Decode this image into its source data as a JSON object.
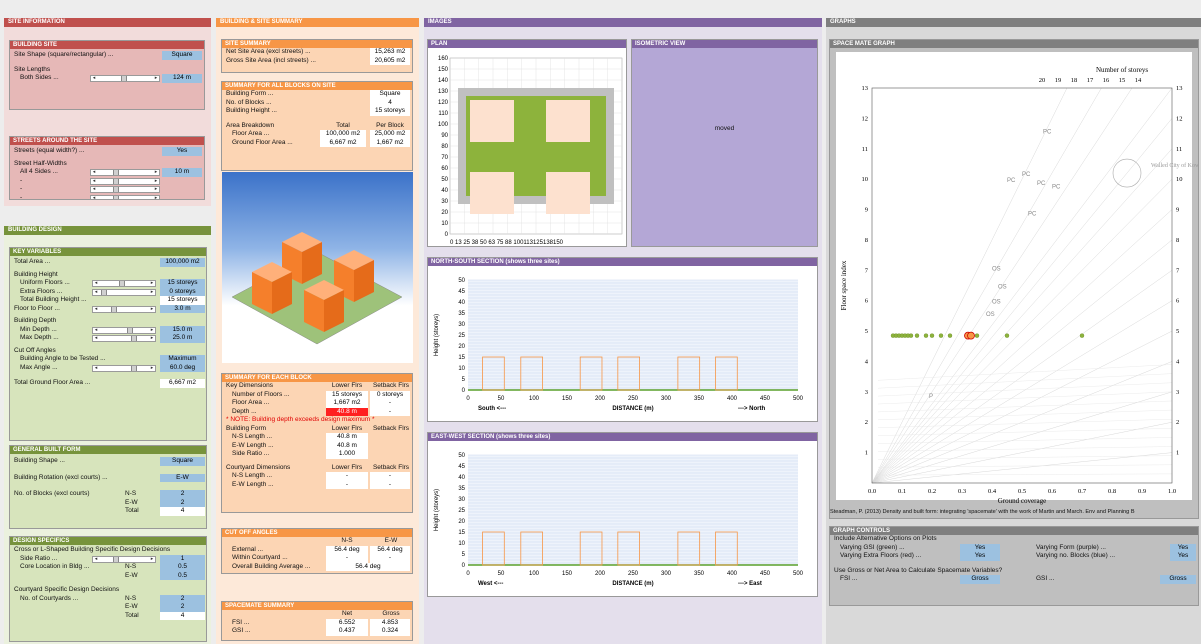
{
  "colors": {
    "site_red": "#c0504d",
    "site_bg": "#e6b8b7",
    "orange": "#f79646",
    "orange_bg": "#fcd5b4",
    "green": "#77933c",
    "green_bg": "#d7e4bc",
    "purple": "#8064a2",
    "purple_bg": "#ccc0da",
    "grey": "#7f7f7f",
    "blue_val": "#9cc1e0"
  },
  "site_info": {
    "title": "SITE INFORMATION",
    "building_site": {
      "title": "BUILDING SITE",
      "shape_label": "Site Shape (square/rectangular) ...",
      "shape_value": "Square",
      "lengths_label": "Site Lengths",
      "both_label": "Both Sides ...",
      "both_value": "124 m"
    },
    "streets": {
      "title": "STREETS AROUND THE SITE",
      "equal_label": "Streets (equal width?) ...",
      "equal_value": "Yes",
      "half_label": "Street Half-Widths",
      "all4_label": "All 4 Sides ...",
      "all4_value": "10 m",
      "dash": "-"
    }
  },
  "building_design": {
    "title": "BUILDING DESIGN",
    "key": {
      "title": "KEY VARIABLES",
      "total_area_label": "Total Area ...",
      "total_area_value": "100,000 m2",
      "height_label": "Building Height",
      "uniform_label": "Uniform Floors ...",
      "uniform_value": "15 storeys",
      "extra_label": "Extra Floors ...",
      "extra_value": "0 storeys",
      "total_height_label": "Total Building Height ...",
      "total_height_value": "15 storeys",
      "f2f_label": "Floor to Floor ...",
      "f2f_value": "3.0 m",
      "depth_label": "Building Depth",
      "min_depth_label": "Min Depth ...",
      "min_depth_value": "15.0 m",
      "max_depth_label": "Max Depth ...",
      "max_depth_value": "25.0 m",
      "cutoff_label": "Cut Off Angles",
      "tested_label": "Building Angle to be Tested ...",
      "tested_value": "Maximum",
      "max_angle_label": "Max Angle ...",
      "max_angle_value": "60.0 deg",
      "tgfa_label": "Total Ground Floor Area ...",
      "tgfa_value": "6,667 m2"
    },
    "general": {
      "title": "GENERAL BUILT FORM",
      "shape_label": "Building Shape ...",
      "shape_value": "Square",
      "rotation_label": "Building Rotation (excl courts) ...",
      "rotation_value": "E-W",
      "blocks_label": "No. of Blocks (excl courts)",
      "ns": "N-S",
      "ew": "E-W",
      "total": "Total",
      "ns_value": "2",
      "ew_value": "2",
      "total_value": "4"
    },
    "specifics": {
      "title": "DESIGN SPECIFICS",
      "cross_label": "Cross or L-Shaped Building Specific Design Decisions",
      "side_label": "Side Ratio ...",
      "side_value": "1",
      "core_label": "Core Location in Bldg ...",
      "ns": "N-S",
      "ew": "E-W",
      "core_ns": "0.5",
      "core_ew": "0.5",
      "court_label": "Courtyard Specific Design Decisions",
      "courts_label": "No. of Courtyards ...",
      "total": "Total",
      "c_ns": "2",
      "c_ew": "2",
      "c_total": "4"
    }
  },
  "summary": {
    "title": "BUILDING & SITE SUMMARY",
    "site": {
      "title": "SITE SUMMARY",
      "net_label": "Net Site Area (excl streets) ...",
      "net_value": "15,263 m2",
      "gross_label": "Gross Site Area (incl streets) ...",
      "gross_value": "20,605 m2"
    },
    "all_blocks": {
      "title": "SUMMARY FOR ALL BLOCKS ON SITE",
      "form_label": "Building Form ...",
      "form_value": "Square",
      "blocks_label": "No. of Blocks ...",
      "blocks_value": "4",
      "height_label": "Building Height ...",
      "height_value": "15 storeys",
      "breakdown_label": "Area Breakdown",
      "total_hdr": "Total",
      "per_hdr": "Per Block",
      "floor_label": "Floor Area ...",
      "floor_total": "100,000 m2",
      "floor_per": "25,000 m2",
      "gfa_label": "Ground Floor Area ...",
      "gfa_total": "6,667 m2",
      "gfa_per": "1,667 m2"
    },
    "each_block": {
      "title": "SUMMARY FOR EACH BLOCK",
      "key_label": "Key Dimensions",
      "lower_hdr": "Lower Flrs",
      "setback_hdr": "Setback Flrs",
      "floors_label": "Number of Floors ...",
      "floors_lower": "15 storeys",
      "floors_setback": "0 storeys",
      "farea_label": "Floor Area ...",
      "farea_lower": "1,667 m2",
      "dash": "-",
      "depth_label": "Depth ...",
      "depth_lower": "40.8 m",
      "note": "* NOTE: Building depth exceeds design maximum *",
      "form_label": "Building Form",
      "ns_label": "N-S Length ...",
      "ns_value": "40.8 m",
      "ew_label": "E-W Length ...",
      "ew_value": "40.8 m",
      "side_label": "Side Ratio ...",
      "side_value": "1.000",
      "court_label": "Courtyard Dimensions",
      "cns_label": "N-S Length ...",
      "cew_label": "E-W Length ..."
    },
    "cutoff": {
      "title": "CUT OFF ANGLES",
      "ns_hdr": "N-S",
      "ew_hdr": "E-W",
      "ext_label": "External ...",
      "ext_ns": "56.4 deg",
      "ext_ew": "56.4 deg",
      "within_label": "Within Courtyard ...",
      "dash": "-",
      "avg_label": "Overall Building Average ...",
      "avg_value": "56.4 deg"
    },
    "spacemate": {
      "title": "SPACEMATE SUMMARY",
      "net_hdr": "Net",
      "gross_hdr": "Gross",
      "fsi_label": "FSI ...",
      "fsi_net": "6.552",
      "fsi_gross": "4.853",
      "gsi_label": "GSI ...",
      "gsi_net": "0.437",
      "gsi_gross": "0.324"
    }
  },
  "images": {
    "title": "IMAGES",
    "plan_title": "PLAN",
    "iso_title": "ISOMETRIC VIEW",
    "iso_text": "moved",
    "plan_y": [
      "160",
      "150",
      "140",
      "130",
      "120",
      "110",
      "100",
      "90",
      "80",
      "70",
      "60",
      "50",
      "40",
      "30",
      "20",
      "10",
      "0"
    ],
    "plan_x": "0  13  25  38  50  63  75  88 100113125138150",
    "ns_title": "NORTH-SOUTH SECTION (shows three sites)",
    "ew_title": "EAST-WEST SECTION (shows three sites)",
    "sec_y": [
      "50",
      "45",
      "40",
      "35",
      "30",
      "25",
      "20",
      "15",
      "10",
      "5",
      "0"
    ],
    "sec_x": [
      "0",
      "50",
      "100",
      "150",
      "200",
      "250",
      "300",
      "350",
      "400",
      "450",
      "500"
    ],
    "ylabel": "Height (storeys)",
    "xlabel": "DISTANCE (m)",
    "ns_left": "South  <---",
    "ns_right": "--->  North",
    "ew_left": "West  <---",
    "ew_right": "--->  East"
  },
  "graphs": {
    "title": "GRAPHS",
    "spacemate_title": "SPACE MATE GRAPH",
    "citation": "Steadman, P. (2013) Density and built form: integrating 'spacemate' with the work of Martin and March. Env and Planning B",
    "controls": {
      "title": "GRAPH CONTROLS",
      "include_label": "Include Alternative Options on Plots",
      "gsi_label": "Varying GSI (green) ...",
      "gsi_value": "Yes",
      "extra_label": "Varying Extra Floors (red) ...",
      "extra_value": "Yes",
      "form_label": "Varying Form (purple) ...",
      "form_value": "Yes",
      "blocks_label": "Varying no. Blocks (blue) ...",
      "blocks_value": "Yes",
      "area_label": "Use Gross or Net Area to Calculate Spacemate Variables?",
      "fsi_label": "FSI ...",
      "fsi_value": "Gross",
      "gsi2_label": "GSI ...",
      "gsi2_value": "Gross"
    }
  },
  "chart_data": {
    "type": "scatter",
    "title": "",
    "xlabel": "Ground coverage",
    "ylabel": "Floor space index",
    "xlim": [
      0,
      1
    ],
    "ylim": [
      0,
      13
    ],
    "xticks": [
      "0.0",
      "0.1",
      "0.2",
      "0.3",
      "0.4",
      "0.5",
      "0.6",
      "0.7",
      "0.8",
      "0.9",
      "1.0"
    ],
    "yticks": [
      "1",
      "2",
      "3",
      "4",
      "5",
      "6",
      "7",
      "8",
      "9",
      "10",
      "11",
      "12",
      "13"
    ],
    "top_axis_label": "Number of storeys",
    "top_ticks": [
      "20",
      "19",
      "18",
      "17",
      "16",
      "15",
      "14"
    ],
    "annotations": [
      "Walled City of Kowloon",
      "PC",
      "OS",
      "P"
    ],
    "series": [
      {
        "values": [
          [
            0.07,
            4.85
          ],
          [
            0.08,
            4.85
          ],
          [
            0.09,
            4.85
          ],
          [
            0.1,
            4.85
          ],
          [
            0.11,
            4.85
          ],
          [
            0.12,
            4.85
          ],
          [
            0.13,
            4.85
          ],
          [
            0.15,
            4.85
          ],
          [
            0.18,
            4.85
          ],
          [
            0.2,
            4.85
          ],
          [
            0.23,
            4.85
          ],
          [
            0.26,
            4.85
          ],
          [
            0.35,
            4.85
          ],
          [
            0.45,
            4.85
          ],
          [
            0.7,
            4.85
          ]
        ]
      },
      {
        "values": [
          [
            0.32,
            4.85
          ],
          [
            0.33,
            4.85
          ]
        ]
      }
    ]
  }
}
